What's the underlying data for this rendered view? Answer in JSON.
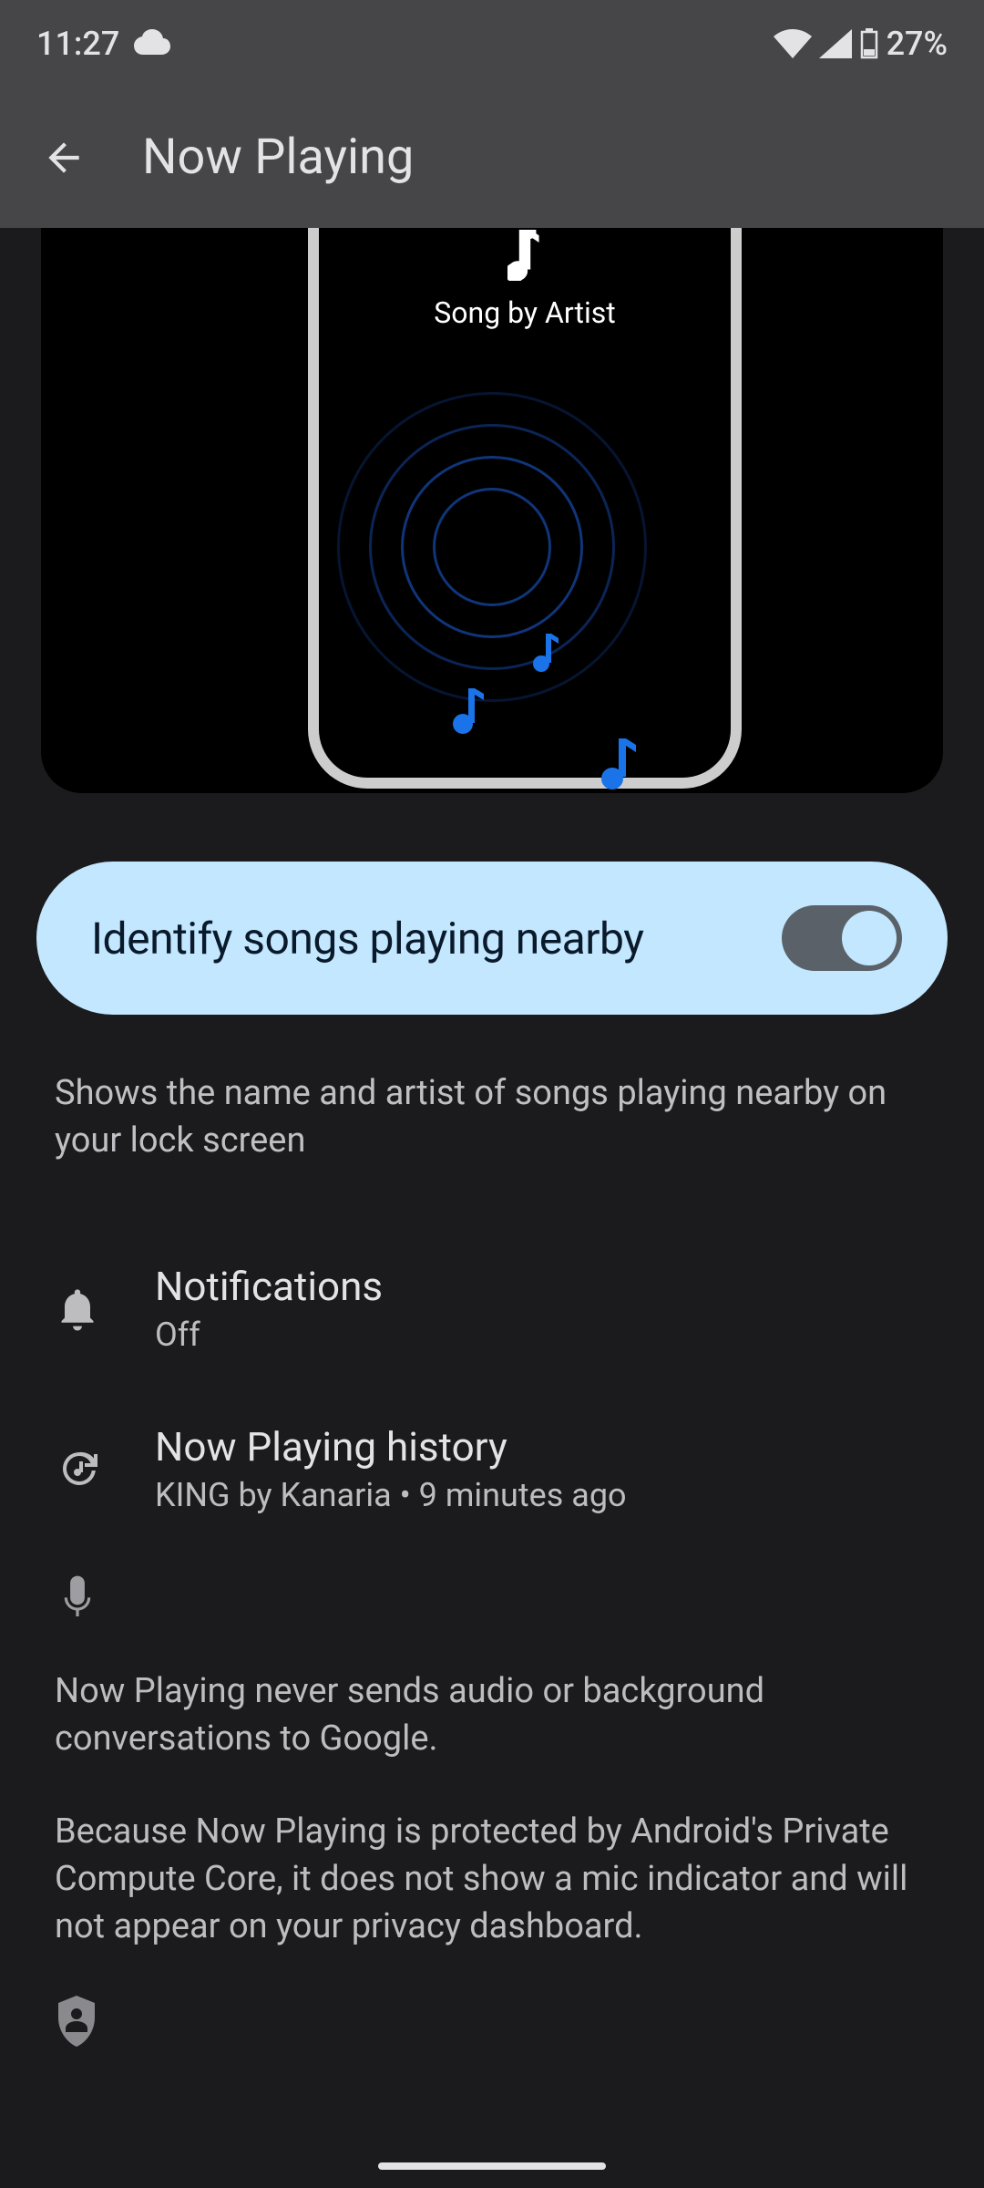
{
  "status": {
    "time": "11:27",
    "battery": "27%"
  },
  "appbar": {
    "title": "Now Playing"
  },
  "illustration": {
    "song_label": "Song by Artist"
  },
  "toggle": {
    "label": "Identify songs playing nearby",
    "on": true
  },
  "description": "Shows the name and artist of songs playing nearby on your lock screen",
  "items": {
    "notifications": {
      "title": "Notifications",
      "subtitle": "Off"
    },
    "history": {
      "title": "Now Playing history",
      "subtitle": "KING by Kanaria • 9 minutes ago"
    }
  },
  "privacy": {
    "p1": "Now Playing never sends audio or background conversations to Google.",
    "p2": "Because Now Playing is protected by Android's Private Compute Core, it does not show a mic indicator and will not appear on your privacy dashboard."
  }
}
